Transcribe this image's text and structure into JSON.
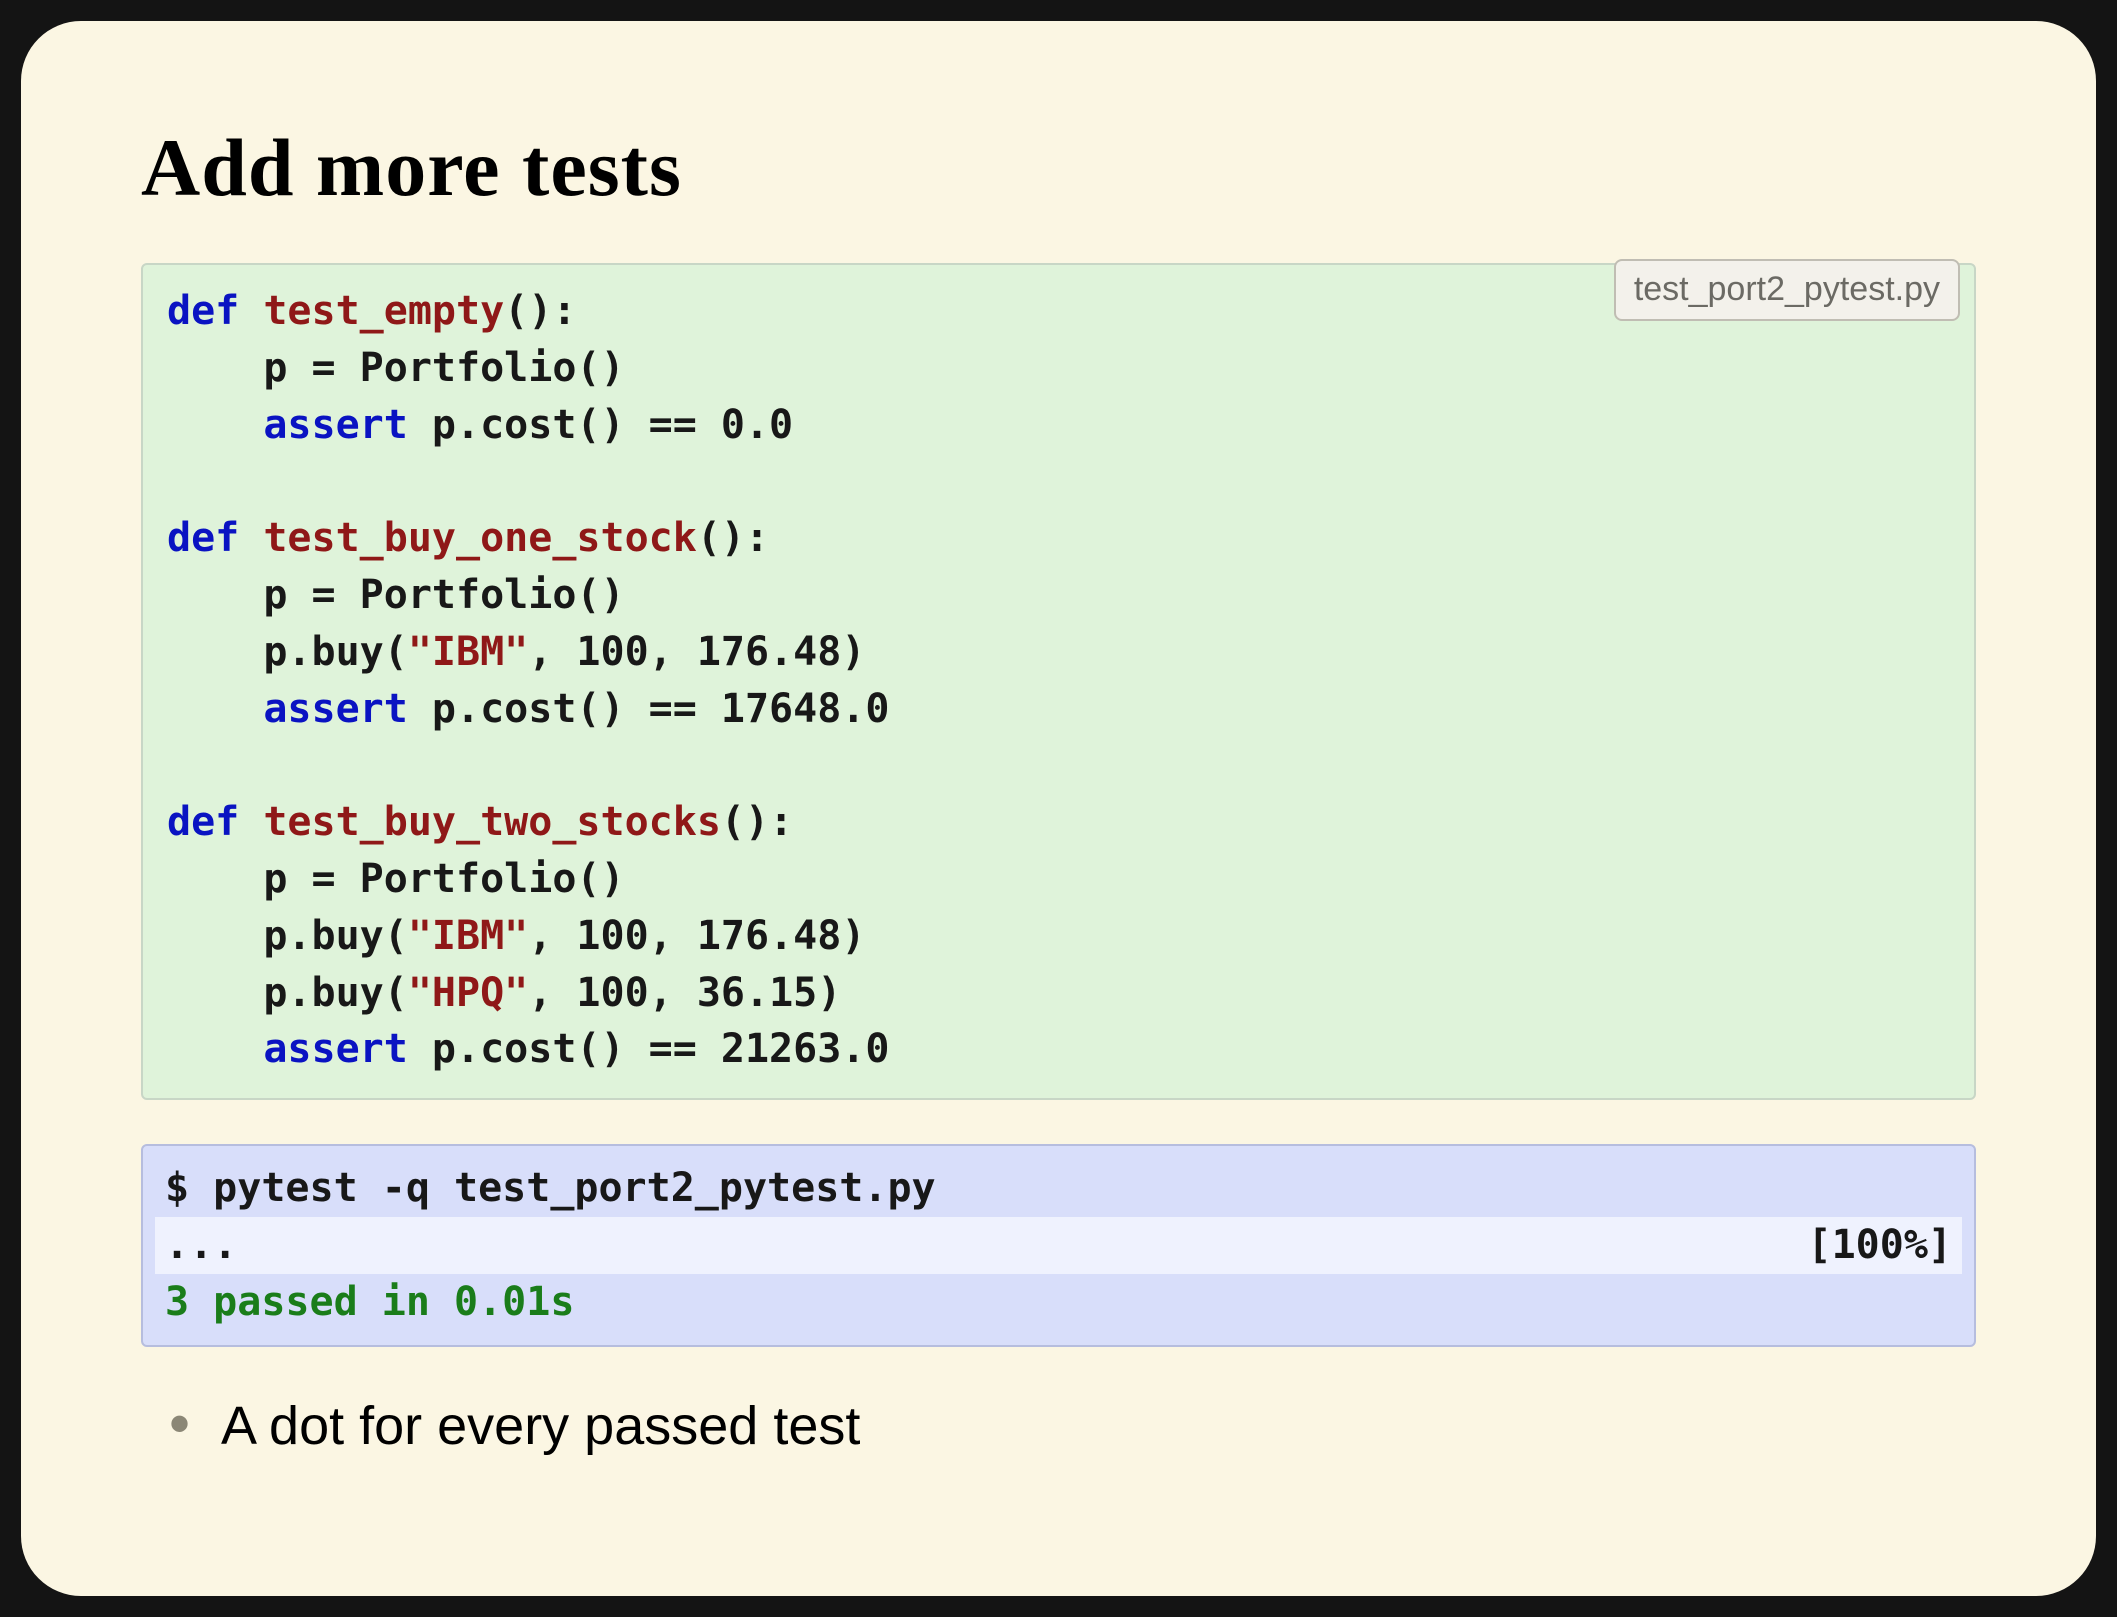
{
  "slide": {
    "title": "Add more tests",
    "code": {
      "filename": "test_port2_pytest.py",
      "l01a": "def",
      "l01b": " ",
      "l01c": "test_empty",
      "l01d": "():",
      "l02": "    p = Portfolio()",
      "l03a": "    ",
      "l03b": "assert",
      "l03c": " p.cost() == 0.0",
      "l05a": "def",
      "l05b": " ",
      "l05c": "test_buy_one_stock",
      "l05d": "():",
      "l06": "    p = Portfolio()",
      "l07a": "    p.buy(",
      "l07b": "\"IBM\"",
      "l07c": ", 100, 176.48)",
      "l08a": "    ",
      "l08b": "assert",
      "l08c": " p.cost() == 17648.0",
      "l10a": "def",
      "l10b": " ",
      "l10c": "test_buy_two_stocks",
      "l10d": "():",
      "l11": "    p = Portfolio()",
      "l12a": "    p.buy(",
      "l12b": "\"IBM\"",
      "l12c": ", 100, 176.48)",
      "l13a": "    p.buy(",
      "l13b": "\"HPQ\"",
      "l13c": ", 100, 36.15)",
      "l14a": "    ",
      "l14b": "assert",
      "l14c": " p.cost() == 21263.0"
    },
    "terminal": {
      "cmd": "$ pytest -q test_port2_pytest.py",
      "dots": "...",
      "pct": "[100%]",
      "summary": "3 passed in 0.01s"
    },
    "bullets": [
      "A dot for every passed test"
    ]
  }
}
